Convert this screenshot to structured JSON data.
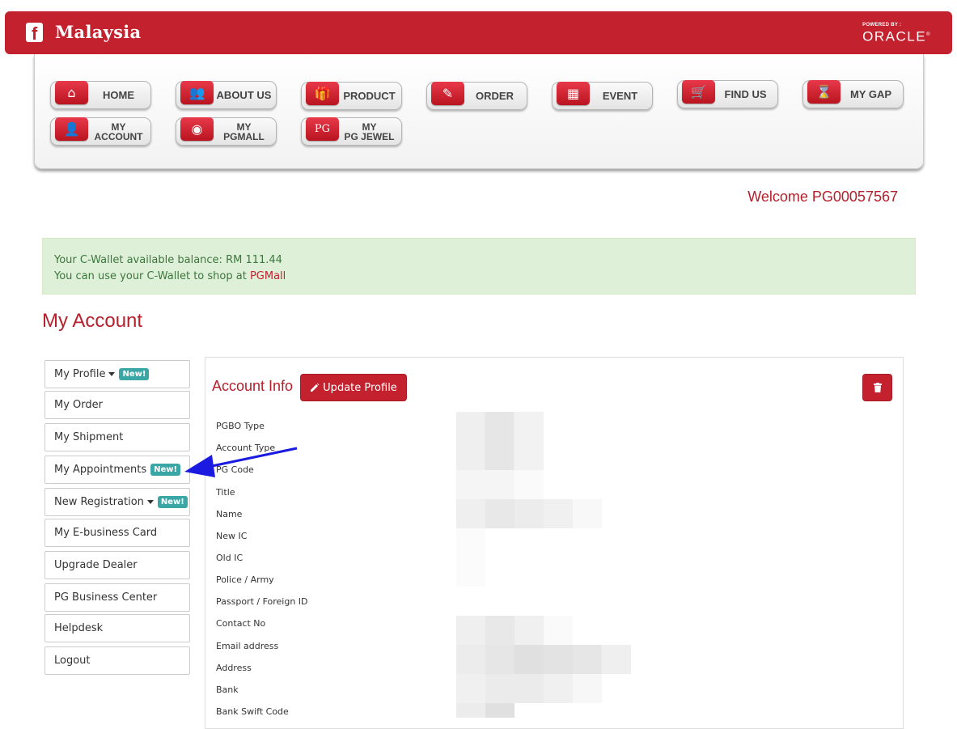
{
  "header": {
    "fb_icon": "facebook-icon",
    "brand": "Malaysia",
    "powered_by": "POWERED BY :",
    "oracle": "ORACLE"
  },
  "menu": [
    {
      "label": "HOME",
      "icon": "home-icon",
      "glyph": "⌂"
    },
    {
      "label": "ABOUT US",
      "icon": "people-icon",
      "glyph": "👥"
    },
    {
      "label": "PRODUCT",
      "icon": "gift-icon",
      "glyph": "🎁"
    },
    {
      "label": "ORDER",
      "icon": "edit-order-icon",
      "glyph": "✎"
    },
    {
      "label": "EVENT",
      "icon": "calendar-icon",
      "glyph": "▦"
    },
    {
      "label": "FIND US",
      "icon": "cart-icon",
      "glyph": "🛒"
    },
    {
      "label": "MY GAP",
      "icon": "hourglass-icon",
      "glyph": "⌛"
    },
    {
      "label": "MY ACCOUNT",
      "l1": "MY",
      "l2": "ACCOUNT",
      "icon": "user-icon",
      "glyph": "👤"
    },
    {
      "label": "MY PGMALL",
      "l1": "MY",
      "l2": "PGMALL",
      "icon": "globe-icon",
      "glyph": "◉"
    },
    {
      "label": "MY PG JEWEL",
      "l1": "MY",
      "l2": "PG JEWEL",
      "icon": "pg-jewel-icon",
      "glyph": "PG"
    }
  ],
  "welcome": "Welcome PG00057567",
  "wallet": {
    "line1": "Your C-Wallet available balance: RM 111.44",
    "line2_prefix": "You can use your C-Wallet to shop at ",
    "line2_link": "PGMall"
  },
  "page_title": "My Account",
  "sidebar": [
    {
      "label": "My Profile",
      "caret": true,
      "badge": "New!"
    },
    {
      "label": "My Order"
    },
    {
      "label": "My Shipment"
    },
    {
      "label": "My Appointments",
      "badge": "New!"
    },
    {
      "label": "New Registration",
      "caret": true,
      "badge": "New!"
    },
    {
      "label": "My E-business Card"
    },
    {
      "label": "Upgrade Dealer"
    },
    {
      "label": "PG Business Center"
    },
    {
      "label": "Helpdesk"
    },
    {
      "label": "Logout"
    }
  ],
  "account": {
    "title": "Account Info",
    "update_button": "Update Profile",
    "delete_icon": "trash-icon",
    "fields": [
      "PGBO Type",
      "Account Type",
      "PG Code",
      "Title",
      "Name",
      "New IC",
      "Old IC",
      "Police / Army",
      "Passport / Foreign ID",
      "Contact No",
      "Email address",
      "Address",
      "Bank",
      "Bank Swift Code"
    ]
  },
  "annotation": {
    "icon": "blue-arrow-icon",
    "color": "#1a1ae0"
  },
  "colors": {
    "brand_red": "#c4212f",
    "success_bg": "#dff0d8",
    "badge_teal": "#3ba6a6"
  }
}
